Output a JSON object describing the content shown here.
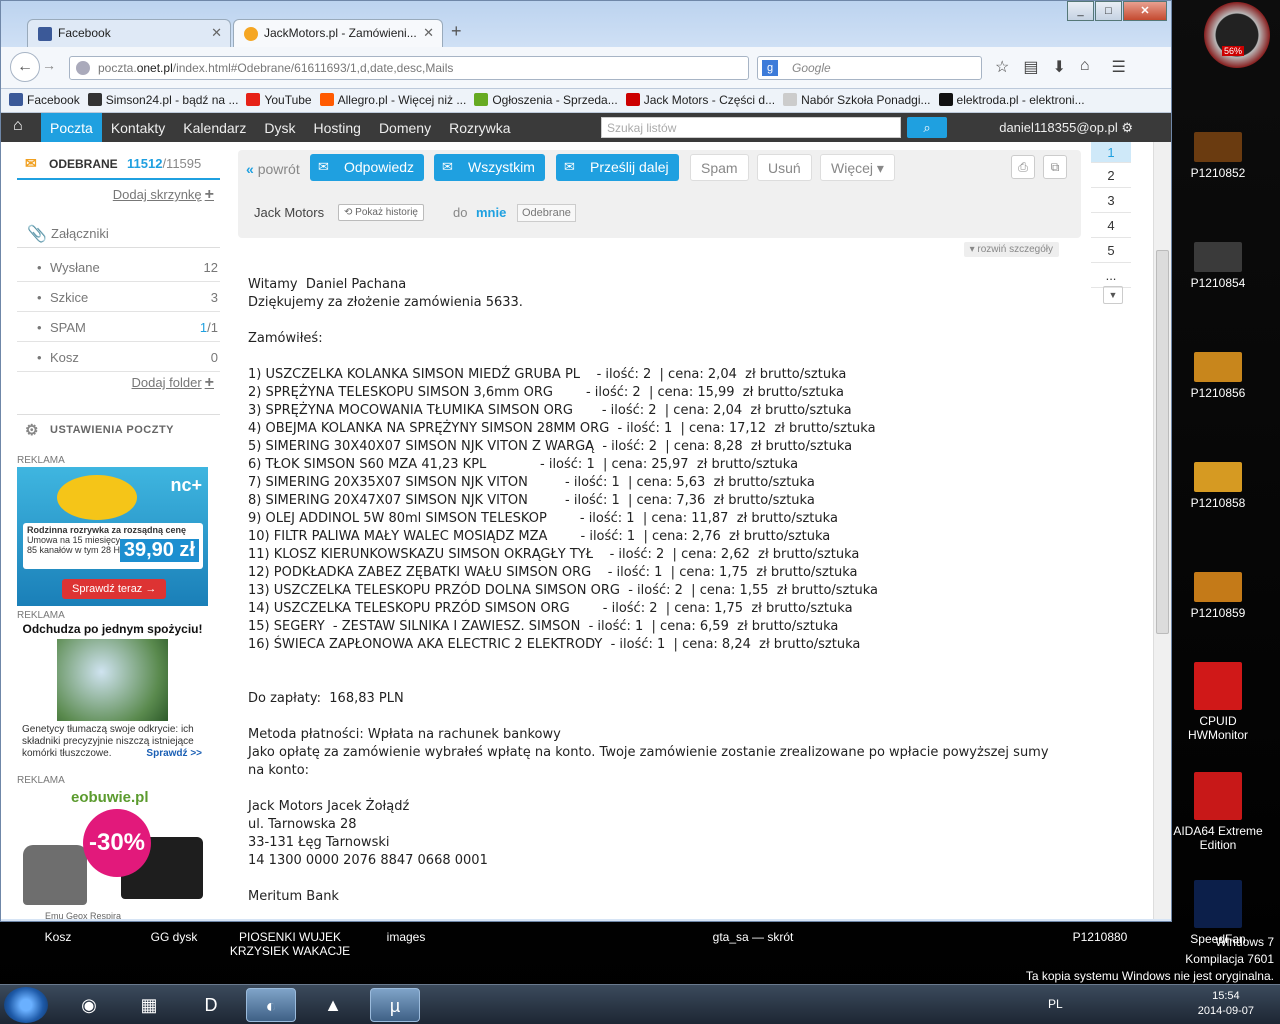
{
  "browser": {
    "tabs": [
      {
        "label": "Facebook",
        "icon_color": "#3b5998"
      },
      {
        "label": "JackMotors.pl - Zamówieni...",
        "icon_color": "#f5a623"
      }
    ],
    "url_prefix": "poczta.",
    "url_domain": "onet.pl",
    "url_rest": "/index.html#Odebrane/61611693/1,d,date,desc,Mails",
    "search_placeholder": "Google",
    "window_min": "_",
    "window_max": "□",
    "window_close": "✕",
    "bookmarks": [
      {
        "label": "Facebook",
        "icon_color": "#3b5998"
      },
      {
        "label": "Simson24.pl - bądź na ...",
        "icon_color": "#333"
      },
      {
        "label": "YouTube",
        "icon_color": "#e62117"
      },
      {
        "label": "Allegro.pl - Więcej niż ...",
        "icon_color": "#ff5a00"
      },
      {
        "label": "Ogłoszenia - Sprzeda...",
        "icon_color": "#6a2"
      },
      {
        "label": "Jack Motors - Części d...",
        "icon_color": "#c00"
      },
      {
        "label": "Nabór Szkoła Ponadgi...",
        "icon_color": "#ccc"
      },
      {
        "label": "elektroda.pl - elektroni...",
        "icon_color": "#111"
      }
    ]
  },
  "onet": {
    "nav": [
      "Poczta",
      "Kontakty",
      "Kalendarz",
      "Dysk",
      "Hosting",
      "Domeny",
      "Rozrywka"
    ],
    "search_placeholder": "Szukaj listów",
    "user": "daniel118355@op.pl"
  },
  "sidebar": {
    "inbox_label": "ODEBRANE",
    "inbox_unread": "11512",
    "inbox_total": "/11595",
    "add_mailbox": "Dodaj skrzynkę",
    "attachments": "Załączniki",
    "folders": [
      {
        "label": "Wysłane",
        "count": "12",
        "unread": ""
      },
      {
        "label": "Szkice",
        "count": "3",
        "unread": ""
      },
      {
        "label": "SPAM",
        "count": "/1",
        "unread": "1"
      },
      {
        "label": "Kosz",
        "count": "0",
        "unread": ""
      }
    ],
    "add_folder": "Dodaj folder",
    "settings": "USTAWIENIA POCZTY",
    "ad_label": "REKLAMA",
    "ad1": {
      "brand": "nc+",
      "headline": "Rodzinna rozrywka za rozsądną cenę",
      "line1": "Umowa na 15 miesięcy",
      "line2": "85 kanałów w tym 28 HD",
      "price": "39,90 zł",
      "cta": "Sprawdź teraz →"
    },
    "ad2": {
      "title": "Odchudza po jednym spożyciu!",
      "text": "Genetycy tłumaczą swoje odkrycie: ich składniki precyzyjnie niszczą istniejące komórki tłuszczowe.",
      "link": "Sprawdź >>"
    },
    "ad3": {
      "brand": "eobuwie.pl",
      "badge": "-30%",
      "caption": "Emu          Geox Respira"
    }
  },
  "message": {
    "back": "powrót",
    "buttons": {
      "reply": "Odpowiedz",
      "reply_all": "Wszystkim",
      "forward": "Prześlij dalej",
      "spam": "Spam",
      "delete": "Usuń",
      "more": "Więcej"
    },
    "from": "Jack Motors",
    "history": "Pokaż historię",
    "to_prefix": "do",
    "to": "mnie",
    "folder_tag": "Odebrane",
    "details": "rozwiń szczegóły",
    "body": "Witamy  Daniel Pachana\nDziękujemy za złożenie zamówienia 5633.\n\nZamówiłeś:\n\n1) USZCZELKA KOLANKA SIMSON MIEDŹ GRUBA PL    - ilość: 2  | cena: 2,04  zł brutto/sztuka\n2) SPRĘŻYNA TELESKOPU SIMSON 3,6mm ORG        - ilość: 2  | cena: 15,99  zł brutto/sztuka\n3) SPRĘŻYNA MOCOWANIA TŁUMIKA SIMSON ORG       - ilość: 2  | cena: 2,04  zł brutto/sztuka\n4) OBEJMA KOLANKA NA SPRĘŻYNY SIMSON 28MM ORG  - ilość: 1  | cena: 17,12  zł brutto/sztuka\n5) SIMERING 30X40X07 SIMSON NJK VITON Z WARGĄ  - ilość: 2  | cena: 8,28  zł brutto/sztuka\n6) TŁOK SIMSON S60 MZA 41,23 KPL             - ilość: 1  | cena: 25,97  zł brutto/sztuka\n7) SIMERING 20X35X07 SIMSON NJK VITON         - ilość: 1  | cena: 5,63  zł brutto/sztuka\n8) SIMERING 20X47X07 SIMSON NJK VITON         - ilość: 1  | cena: 7,36  zł brutto/sztuka\n9) OLEJ ADDINOL 5W 80ml SIMSON TELESKOP        - ilość: 1  | cena: 11,87  zł brutto/sztuka\n10) FILTR PALIWA MAŁY WALEC MOSIĄDZ MZA        - ilość: 1  | cena: 2,76  zł brutto/sztuka\n11) KLOSZ KIERUNKOWSKAZU SIMSON OKRĄGŁY TYŁ    - ilość: 2  | cena: 2,62  zł brutto/sztuka\n12) PODKŁADKA ZABEZ ZĘBATKI WAŁU SIMSON ORG    - ilość: 1  | cena: 1,75  zł brutto/sztuka\n13) USZCZELKA TELESKOPU PRZÓD DOLNA SIMSON ORG  - ilość: 2  | cena: 1,55  zł brutto/sztuka\n14) USZCZELKA TELESKOPU PRZÓD SIMSON ORG        - ilość: 2  | cena: 1,75  zł brutto/sztuka\n15) SEGERY  - ZESTAW SILNIKA I ZAWIESZ. SIMSON  - ilość: 1  | cena: 6,59  zł brutto/sztuka\n16) ŚWIECA ZAPŁONOWA AKA ELECTRIC 2 ELEKTRODY  - ilość: 1  | cena: 8,24  zł brutto/sztuka\n\n\nDo zapłaty:  168,83 PLN\n\nMetoda płatności: Wpłata na rachunek bankowy\nJako opłatę za zamówienie wybrałeś wpłatę na konto. Twoje zamówienie zostanie zrealizowane po wpłacie powyższej sumy\nna konto:\n\nJack Motors Jacek Żołądź\nul. Tarnowska 28\n33-131 Łęg Tarnowski\n14 1300 0000 2076 8847 0668 0001\n\nMeritum Bank"
  },
  "pager": [
    "1",
    "2",
    "3",
    "4",
    "5",
    "..."
  ],
  "desktop": {
    "gauge_value": "56%",
    "icons": [
      {
        "label": "P1210852",
        "color": "#6a3b10"
      },
      {
        "label": "P1210854",
        "color": "#3a3a3a"
      },
      {
        "label": "P1210856",
        "color": "#c8861c"
      },
      {
        "label": "P1210858",
        "color": "#d69a22"
      },
      {
        "label": "P1210859",
        "color": "#c47a18"
      },
      {
        "label": "CPUID HWMonitor",
        "color": "#d01818"
      },
      {
        "label": "AIDA64 Extreme Edition",
        "color": "#c81818"
      },
      {
        "label": "SpeedFan",
        "color": "#0c1f4a"
      }
    ],
    "bottom_labels": [
      "Kosz",
      "GG dysk",
      "PIOSENKI WUJEK KRZYSIEK WAKACJE",
      "images",
      "gta_sa — skrót",
      "P1210880"
    ],
    "win_info": [
      "Windows 7",
      "Kompilacja 7601",
      "Ta kopia systemu Windows nie jest oryginalna."
    ]
  },
  "taskbar": {
    "lang": "PL",
    "time": "15:54",
    "date": "2014-09-07"
  }
}
